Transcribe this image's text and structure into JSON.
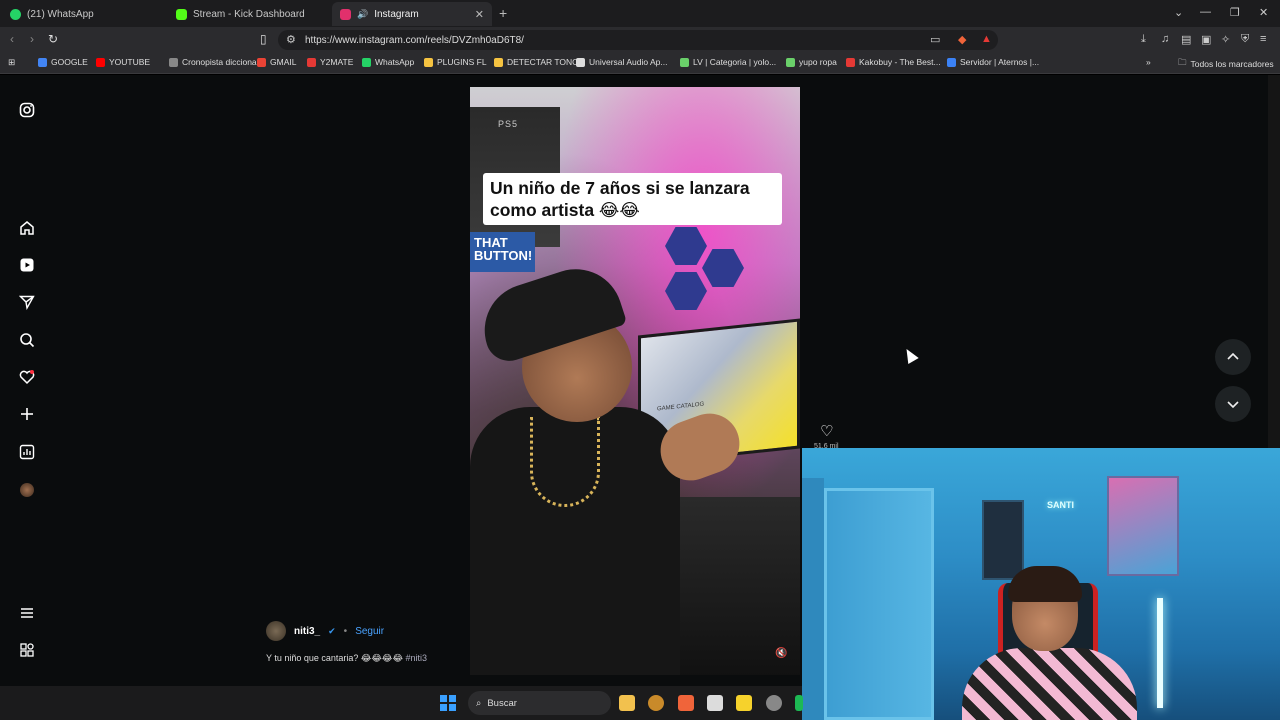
{
  "browser": {
    "tabs": [
      {
        "label": "(21) WhatsApp",
        "color": "#25d366"
      },
      {
        "label": "Stream - Kick Dashboard",
        "color": "#53fc18"
      },
      {
        "label": "Instagram",
        "color": "#e1306c"
      }
    ],
    "url": "https://www.instagram.com/reels/DVZmh0aD6T8/",
    "bookmarks": [
      {
        "label": "GOOGLE",
        "color": "#4285f4"
      },
      {
        "label": "YOUTUBE",
        "color": "#ff0000"
      },
      {
        "label": "Cronopista diccionа...",
        "color": "#888888"
      },
      {
        "label": "GMAIL",
        "color": "#ea4335"
      },
      {
        "label": "Y2MATE",
        "color": "#e53935"
      },
      {
        "label": "WhatsApp",
        "color": "#25d366"
      },
      {
        "label": "PLUGINS FL",
        "color": "#f6c341"
      },
      {
        "label": "DETECTAR TONO",
        "color": "#f6c341"
      },
      {
        "label": "Universal Audio Ap...",
        "color": "#dddddd"
      },
      {
        "label": "LV | Categoria | yolo...",
        "color": "#6ad06a"
      },
      {
        "label": "yupo ropa",
        "color": "#6ad06a"
      },
      {
        "label": "Kakobuy - The Best...",
        "color": "#e53935"
      },
      {
        "label": "Servidor | Aternos |...",
        "color": "#3b82f6"
      }
    ],
    "all_bookmarks": "Todos los marcadores"
  },
  "instagram": {
    "overlay_caption": "Un niño de 7 años si se lanzara como artista 😂😂",
    "video_texts": {
      "shelf": "PS5",
      "poster": "THAT BUTTON!",
      "monitor": "GAME CATALOG"
    },
    "author": "niti3_",
    "follow": "Seguir",
    "caption": "Y tu niño que cantaria? 😂😂😂😂",
    "hashtag": "#niti3",
    "like_count": "51,6 mil",
    "webcam_neon": "SANTI"
  },
  "taskbar": {
    "search_placeholder": "Buscar"
  }
}
